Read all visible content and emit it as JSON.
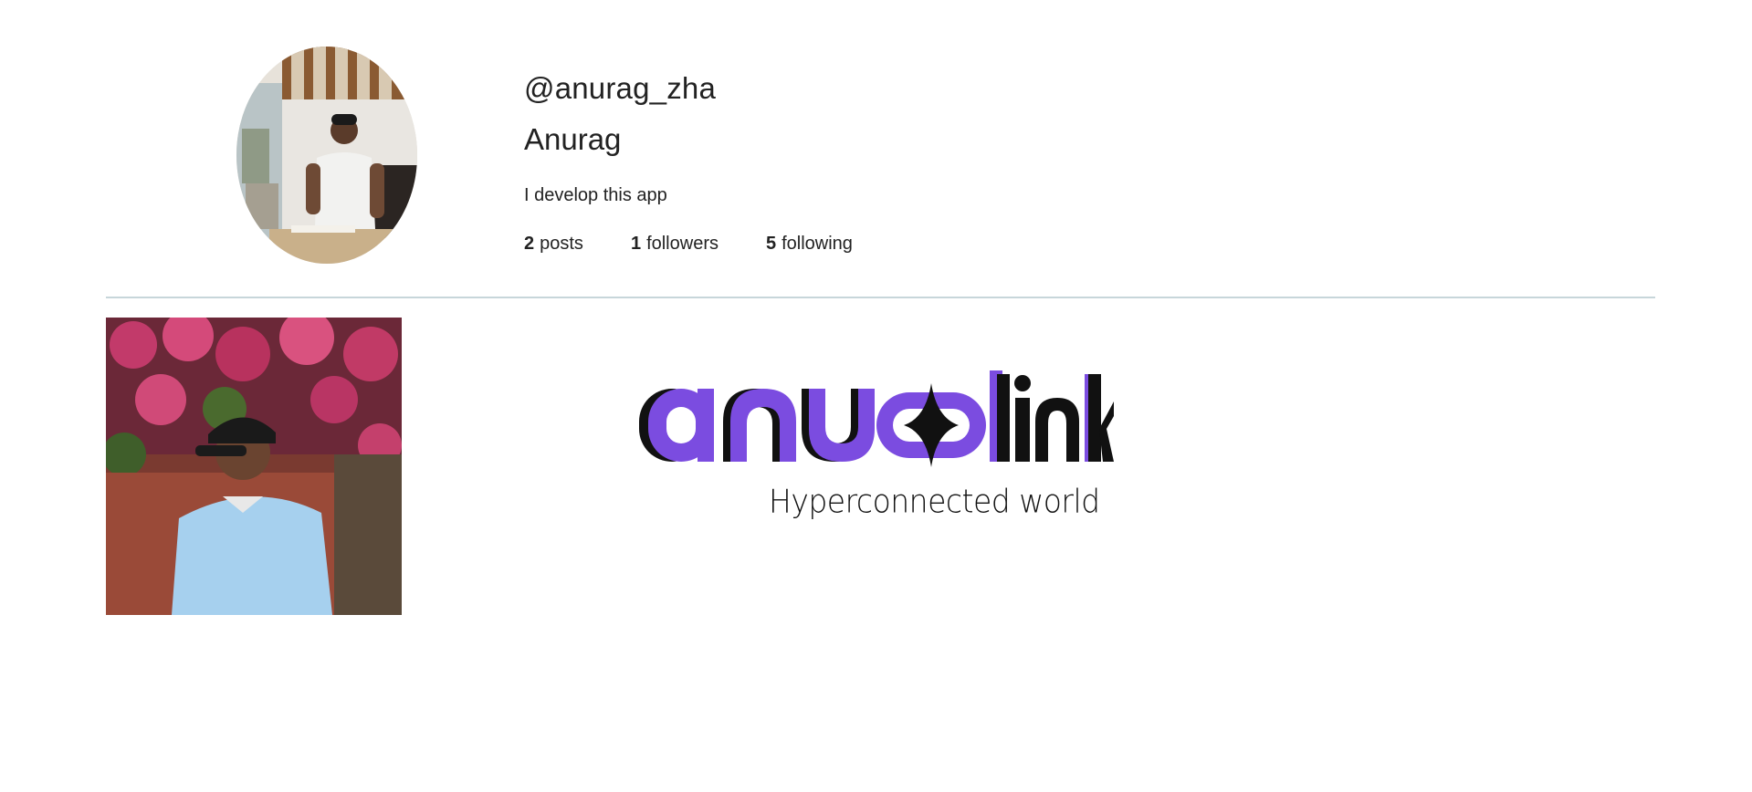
{
  "profile": {
    "username": "@anurag_zha",
    "name": "Anurag",
    "bio": "I develop this app",
    "stats": {
      "posts_count": "2",
      "posts_label": "posts",
      "followers_count": "1",
      "followers_label": "followers",
      "following_count": "5",
      "following_label": "following"
    }
  },
  "posts": {
    "logo": {
      "wordmark": "anu link",
      "tagline": "Hyperconnected world"
    }
  },
  "colors": {
    "brand_purple": "#7b4ce0",
    "divider": "#c7d6da",
    "text": "#222222"
  }
}
